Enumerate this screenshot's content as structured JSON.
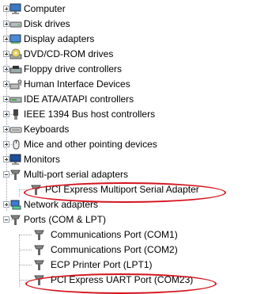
{
  "tree": {
    "categories": [
      {
        "label": "Computer",
        "icon": "monitor-icon"
      },
      {
        "label": "Disk drives",
        "icon": "disk-drive-icon"
      },
      {
        "label": "Display adapters",
        "icon": "display-adapter-icon"
      },
      {
        "label": "DVD/CD-ROM drives",
        "icon": "optical-drive-icon"
      },
      {
        "label": "Floppy drive controllers",
        "icon": "floppy-controller-icon"
      },
      {
        "label": "Human Interface Devices",
        "icon": "hid-icon"
      },
      {
        "label": "IDE ATA/ATAPI controllers",
        "icon": "ide-controller-icon"
      },
      {
        "label": "IEEE 1394 Bus host controllers",
        "icon": "firewire-icon"
      },
      {
        "label": "Keyboards",
        "icon": "keyboard-icon"
      },
      {
        "label": "Mice and other pointing devices",
        "icon": "mouse-icon"
      },
      {
        "label": "Monitors",
        "icon": "monitor-icon"
      },
      {
        "label": "Multi-port serial adapters",
        "icon": "serial-port-icon"
      }
    ],
    "multiport_child": {
      "label": "PCI Express Multiport Serial Adapter",
      "icon": "serial-port-icon"
    },
    "network": {
      "label": "Network adapters",
      "icon": "network-adapter-icon"
    },
    "ports": {
      "label": "Ports (COM & LPT)",
      "icon": "serial-port-icon"
    },
    "ports_children": [
      {
        "label": "Communications Port (COM1)",
        "icon": "serial-port-icon"
      },
      {
        "label": "Communications Port (COM2)",
        "icon": "serial-port-icon"
      },
      {
        "label": "ECP Printer Port (LPT1)",
        "icon": "serial-port-icon"
      },
      {
        "label": "PCI Express UART Port (COM23)",
        "icon": "serial-port-icon"
      }
    ]
  },
  "colors": {
    "highlight": "#d4141e",
    "tree_line": "#a0a0a0"
  }
}
